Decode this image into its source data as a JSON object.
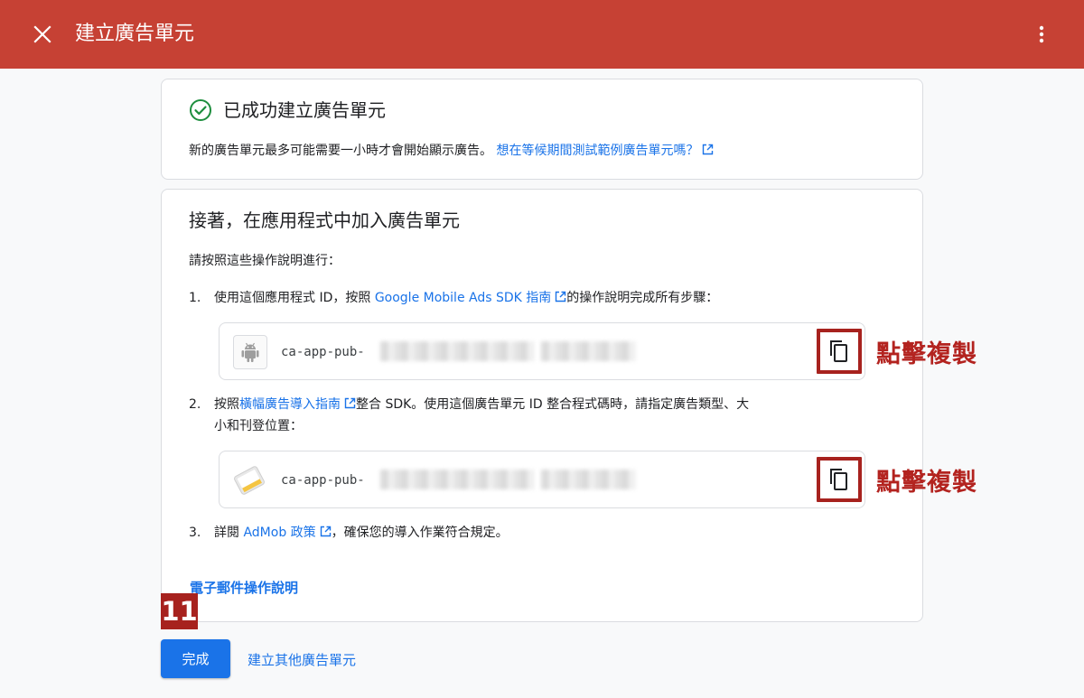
{
  "topbar": {
    "title": "建立廣告單元",
    "close_icon": "close-icon",
    "more_icon": "more-vert-icon"
  },
  "success": {
    "title": "已成功建立廣告單元",
    "description": "新的廣告單元最多可能需要一小時才會開始顯示廣告。",
    "link": "想在等候期間測試範例廣告單元嗎？"
  },
  "next": {
    "title": "接著，在應用程式中加入廣告單元",
    "intro": "請按照這些操作說明進行：",
    "steps": [
      {
        "num": "1.",
        "before": "使用這個應用程式 ID，按照 ",
        "link": "Google Mobile Ads SDK 指南",
        "after": "的操作說明完成所有步驟："
      },
      {
        "num": "2.",
        "before": "按照",
        "link": "橫幅廣告導入指南",
        "after": "整合 SDK。使用這個廣告單元 ID 整合程式碼時，請指定廣告類型、大",
        "line2": "小和刊登位置："
      },
      {
        "num": "3.",
        "before": "詳閱 ",
        "link": "AdMob 政策",
        "after": "，確保您的導入作業符合規定。"
      }
    ],
    "app_id_prefix": "ca-app-pub-",
    "ad_unit_id_prefix": "ca-app-pub-",
    "copy_annotation": "點擊複製",
    "email_link": "電子郵件操作說明"
  },
  "step_badge": "11",
  "footer": {
    "done_label": "完成",
    "create_other_label": "建立其他廣告單元"
  },
  "colors": {
    "topbar": "#c64134",
    "link": "#1a73e8",
    "primary_button": "#1a73e8",
    "annotation": "#a7221e",
    "success_check": "#1e8e3e"
  }
}
